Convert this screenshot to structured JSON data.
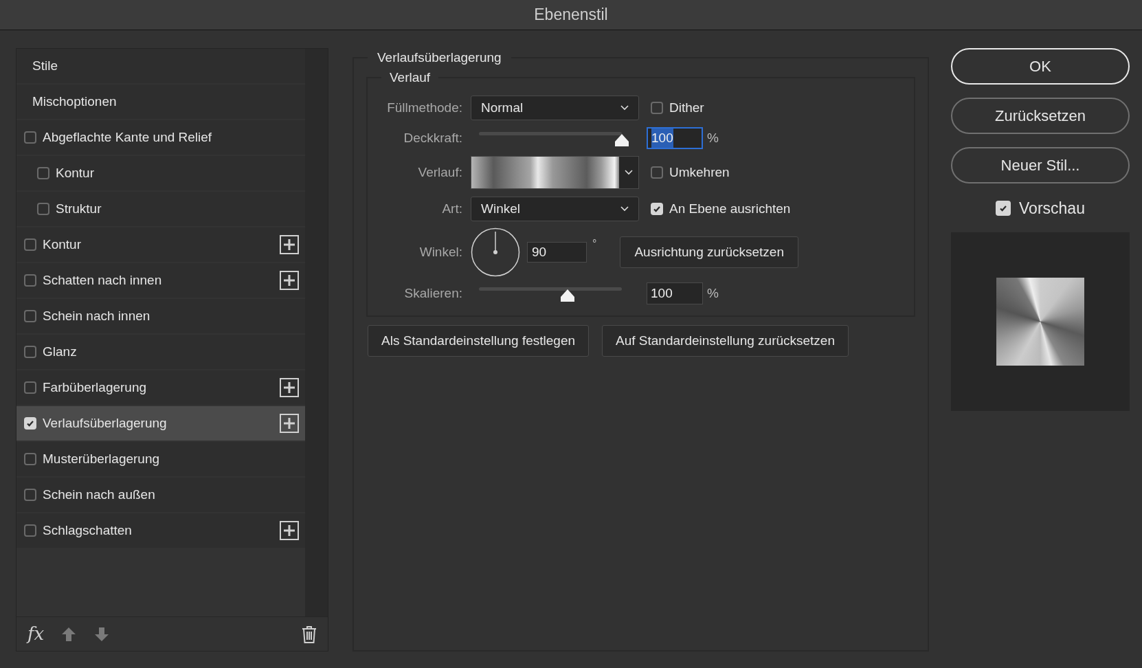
{
  "window": {
    "title": "Ebenenstil"
  },
  "sidebar": {
    "items": [
      {
        "kind": "header",
        "label": "Stile",
        "selected": false
      },
      {
        "kind": "header",
        "label": "Mischoptionen",
        "selected": false
      },
      {
        "kind": "checkbox",
        "label": "Abgeflachte Kante und Relief",
        "checked": false,
        "selected": false,
        "add": false,
        "children": [
          {
            "kind": "checkbox",
            "label": "Kontur",
            "checked": false,
            "selected": false,
            "add": false
          },
          {
            "kind": "checkbox",
            "label": "Struktur",
            "checked": false,
            "selected": false,
            "add": false
          }
        ]
      },
      {
        "kind": "checkbox",
        "label": "Kontur",
        "checked": false,
        "selected": false,
        "add": true
      },
      {
        "kind": "checkbox",
        "label": "Schatten nach innen",
        "checked": false,
        "selected": false,
        "add": true
      },
      {
        "kind": "checkbox",
        "label": "Schein nach innen",
        "checked": false,
        "selected": false,
        "add": false
      },
      {
        "kind": "checkbox",
        "label": "Glanz",
        "checked": false,
        "selected": false,
        "add": false
      },
      {
        "kind": "checkbox",
        "label": "Farbüberlagerung",
        "checked": false,
        "selected": false,
        "add": true
      },
      {
        "kind": "checkbox",
        "label": "Verlaufsüberlagerung",
        "checked": true,
        "selected": true,
        "add": true
      },
      {
        "kind": "checkbox",
        "label": "Musterüberlagerung",
        "checked": false,
        "selected": false,
        "add": false
      },
      {
        "kind": "checkbox",
        "label": "Schein nach außen",
        "checked": false,
        "selected": false,
        "add": false
      },
      {
        "kind": "checkbox",
        "label": "Schlagschatten",
        "checked": false,
        "selected": false,
        "add": true
      }
    ],
    "toolbar": {
      "fx": "fx"
    }
  },
  "panel": {
    "title": "Verlaufsüberlagerung",
    "group": "Verlauf",
    "blend": {
      "label": "Füllmethode:",
      "value": "Normal"
    },
    "dither": {
      "label": "Dither",
      "checked": false
    },
    "opacity": {
      "label": "Deckkraft:",
      "level": 1.0,
      "value": "100",
      "unit": "%"
    },
    "gradient": {
      "label": "Verlauf:"
    },
    "reverse": {
      "label": "Umkehren",
      "checked": false
    },
    "style": {
      "label": "Art:",
      "value": "Winkel"
    },
    "align": {
      "label": "An Ebene ausrichten",
      "checked": true
    },
    "angle": {
      "label": "Winkel:",
      "value": "90",
      "unit": "°"
    },
    "reset_align": "Ausrichtung zurücksetzen",
    "scale": {
      "label": "Skalieren:",
      "level": 0.62,
      "value": "100",
      "unit": "%"
    },
    "buttons": [
      "Als Standardeinstellung festlegen",
      "Auf Standardeinstellung zurücksetzen"
    ]
  },
  "actions": [
    {
      "label": "OK",
      "default": true
    },
    {
      "label": "Zurücksetzen",
      "default": false
    },
    {
      "label": "Neuer Stil...",
      "default": false
    }
  ],
  "preview": {
    "label": "Vorschau",
    "checked": true
  }
}
